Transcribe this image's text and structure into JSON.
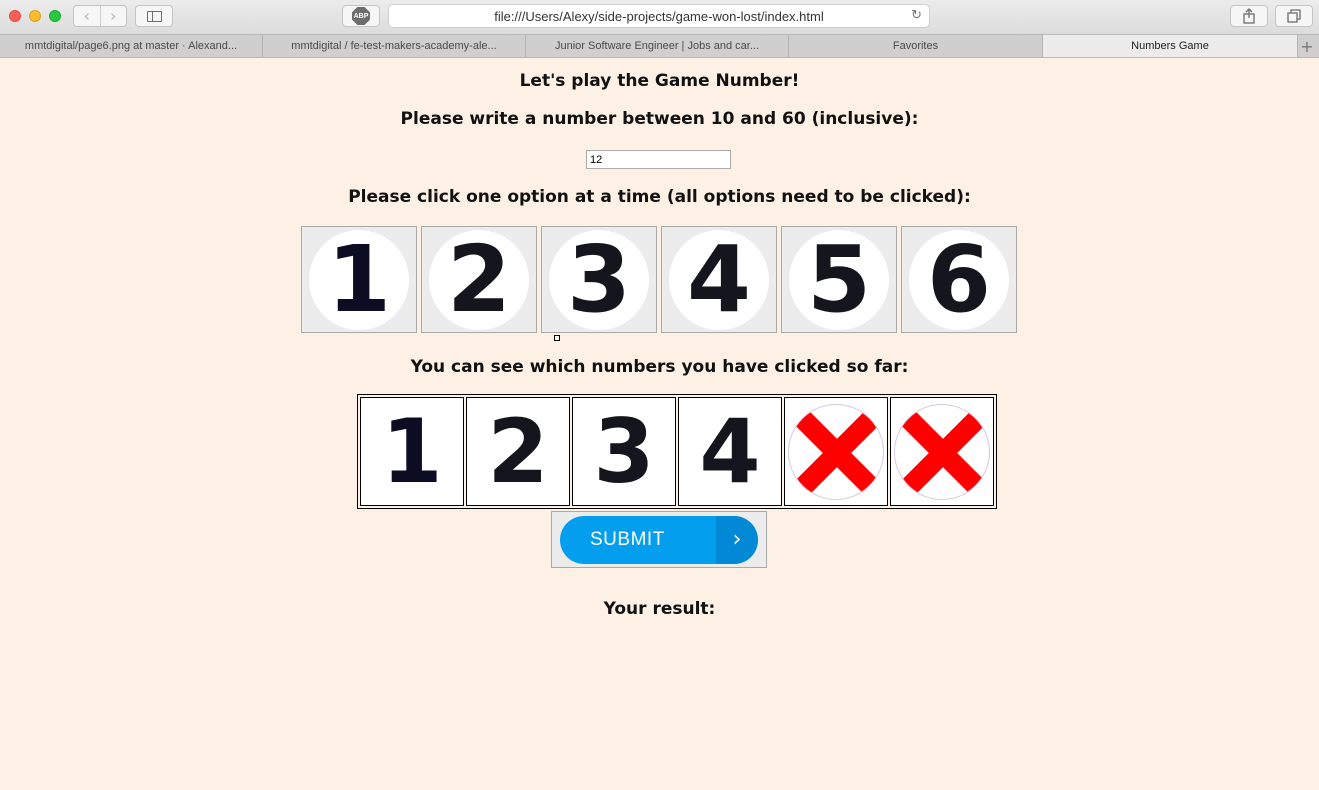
{
  "browser": {
    "url": "file:///Users/Alexy/side-projects/game-won-lost/index.html",
    "abp_label": "ABP",
    "tabs": [
      {
        "label": "mmtdigital/page6.png at master · Alexand..."
      },
      {
        "label": "mmtdigital / fe-test-makers-academy-ale..."
      },
      {
        "label": "Junior Software Engineer | Jobs and car..."
      },
      {
        "label": "Favorites"
      },
      {
        "label": "Numbers Game"
      }
    ],
    "icons": {
      "back": "chevron-left-icon",
      "forward": "chevron-right-icon",
      "sidebar": "sidebar-icon",
      "adblock": "adblock-plus-icon",
      "reload": "reload-icon",
      "share": "share-icon",
      "tabs_overview": "tabs-overview-icon",
      "new_tab": "plus-icon"
    }
  },
  "game": {
    "title": "Let's play the Game Number!",
    "prompt_number": "Please write a number between 10 and 60 (inclusive):",
    "number_value": "12",
    "prompt_options": "Please click one option at a time (all options need to be clicked):",
    "options": [
      "1",
      "2",
      "3",
      "4",
      "5",
      "6"
    ],
    "clicked_heading": "You can see which numbers you have clicked so far:",
    "clicked": [
      {
        "value": "1",
        "state": "clicked"
      },
      {
        "value": "2",
        "state": "clicked"
      },
      {
        "value": "3",
        "state": "clicked"
      },
      {
        "value": "4",
        "state": "clicked"
      },
      {
        "value": "",
        "state": "not-clicked"
      },
      {
        "value": "",
        "state": "not-clicked"
      }
    ],
    "submit_label": "SUBMIT",
    "result_label": "Your result:"
  },
  "colors": {
    "page_background": "#fdf0e4",
    "submit_blue": "#049eef",
    "x_red": "#ff0000"
  }
}
